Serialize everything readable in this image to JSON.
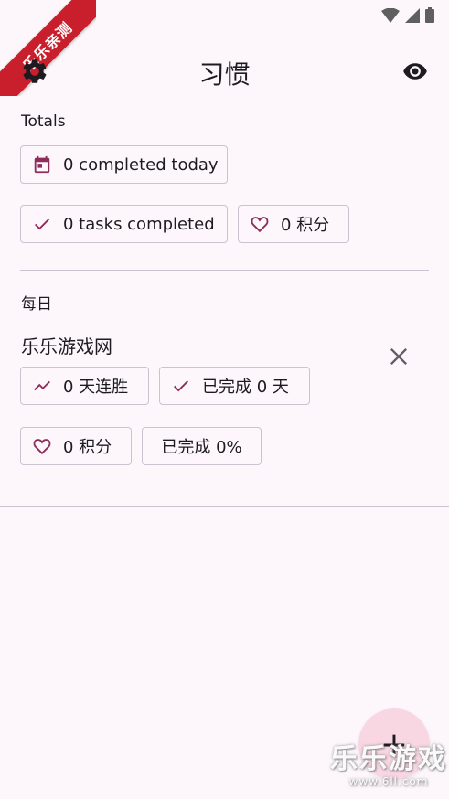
{
  "ribbon": {
    "text": "乐乐亲测"
  },
  "app_bar": {
    "title": "习惯"
  },
  "totals": {
    "label": "Totals",
    "completed_today": "0 completed today",
    "tasks_completed": "0 tasks completed",
    "points": "0 积分"
  },
  "daily": {
    "label": "每日",
    "habit": {
      "name": "乐乐游戏网",
      "streak": "0 天连胜",
      "completed_days": "已完成 0 天",
      "points": "0 积分",
      "completion_rate": "已完成 0%"
    }
  },
  "fab": {
    "label": "+"
  },
  "watermark": {
    "title": "乐乐游戏",
    "url": "www.6ll.com"
  },
  "colors": {
    "accent": "#8e2c5a",
    "fab": "#f8d7e3",
    "background": "#fdf7fc"
  }
}
